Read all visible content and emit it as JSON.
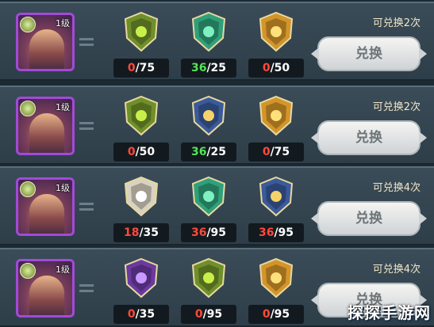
{
  "rows": [
    {
      "level": "1级",
      "portrait": "dark-armored-warrior-portrait",
      "costs": [
        {
          "emblem": "green-eye-emblem",
          "have": "0",
          "need": "/75",
          "status": "lack"
        },
        {
          "emblem": "teal-leaf-emblem",
          "have": "36",
          "need": "/25",
          "status": "ok"
        },
        {
          "emblem": "gold-sun-emblem",
          "have": "0",
          "need": "/50",
          "status": "lack"
        }
      ],
      "limit": "可兑换2次",
      "button": "兑换"
    },
    {
      "level": "1级",
      "portrait": "red-haired-mage-portrait",
      "costs": [
        {
          "emblem": "green-eye-emblem",
          "have": "0",
          "need": "/50",
          "status": "lack"
        },
        {
          "emblem": "blue-star-emblem",
          "have": "36",
          "need": "/25",
          "status": "ok"
        },
        {
          "emblem": "gold-sun-emblem",
          "have": "0",
          "need": "/75",
          "status": "lack"
        }
      ],
      "limit": "可兑换2次",
      "button": "兑换"
    },
    {
      "level": "1级",
      "portrait": "orange-haired-elf-portrait",
      "costs": [
        {
          "emblem": "white-star-emblem",
          "have": "18",
          "need": "/35",
          "status": "lack"
        },
        {
          "emblem": "teal-leaf-emblem",
          "have": "36",
          "need": "/95",
          "status": "lack"
        },
        {
          "emblem": "blue-star-emblem",
          "have": "36",
          "need": "/95",
          "status": "lack"
        }
      ],
      "limit": "可兑换4次",
      "button": "兑换"
    },
    {
      "level": "1级",
      "portrait": "dark-vampire-portrait",
      "costs": [
        {
          "emblem": "purple-crystal-emblem",
          "have": "0",
          "need": "/35",
          "status": "lack"
        },
        {
          "emblem": "green-eye-emblem",
          "have": "0",
          "need": "/95",
          "status": "lack"
        },
        {
          "emblem": "gold-sun-emblem",
          "have": "0",
          "need": "/95",
          "status": "lack"
        }
      ],
      "limit": "可兑换4次",
      "button": "兑换"
    }
  ],
  "watermark": "探探手游网",
  "colors": {
    "lack": "#ff4a3a",
    "ok": "#55e35a",
    "green-eye-emblem": "#6f8f2a",
    "teal-leaf-emblem": "#2fa07a",
    "gold-sun-emblem": "#d3952a",
    "blue-star-emblem": "#3a5a9a",
    "white-star-emblem": "#d8d2c0",
    "purple-crystal-emblem": "#6a3aa0"
  }
}
